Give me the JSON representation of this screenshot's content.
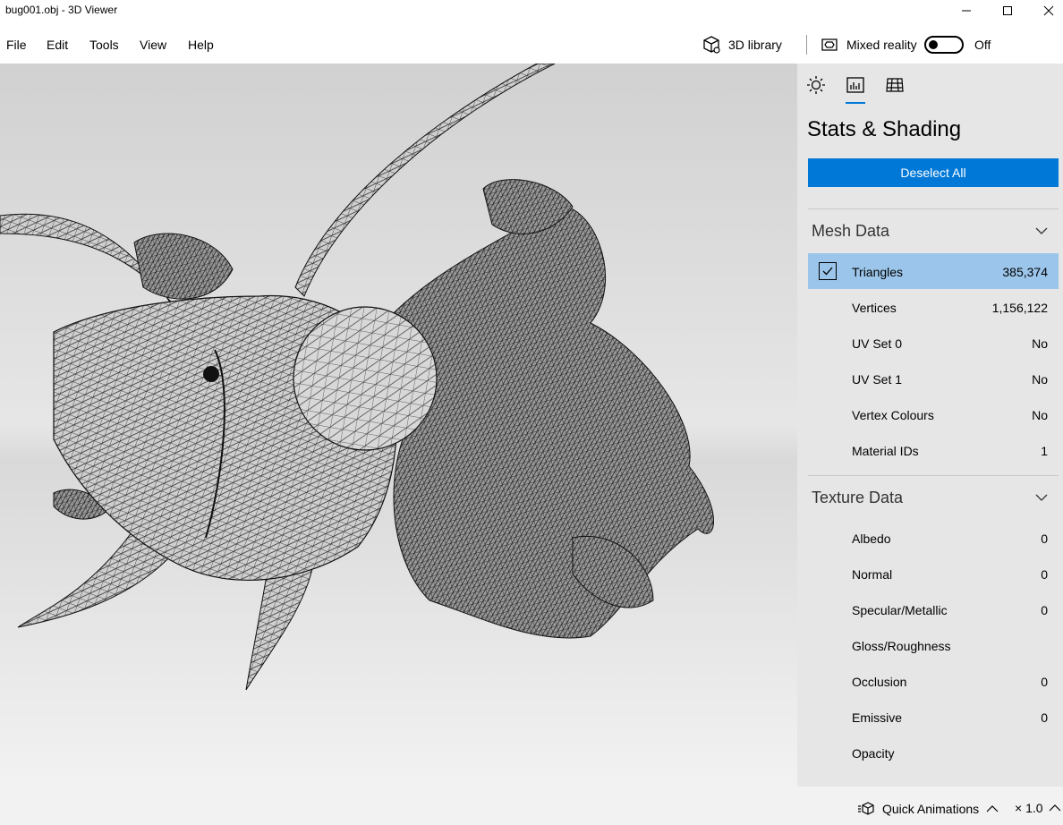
{
  "window": {
    "title": "bug001.obj - 3D Viewer"
  },
  "menu": {
    "items": [
      "File",
      "Edit",
      "Tools",
      "View",
      "Help"
    ],
    "library_label": "3D library",
    "mixed_reality_label": "Mixed reality",
    "mixed_reality_state": "Off"
  },
  "panel": {
    "tabs": [
      "lighting-tab",
      "stats-tab",
      "grid-tab"
    ],
    "active_tab": "stats-tab",
    "title": "Stats & Shading",
    "deselect_label": "Deselect All",
    "mesh_header": "Mesh Data",
    "mesh_rows": [
      {
        "name": "Triangles",
        "value": "385,374",
        "checked": true
      },
      {
        "name": "Vertices",
        "value": "1,156,122"
      },
      {
        "name": "UV Set 0",
        "value": "No"
      },
      {
        "name": "UV Set 1",
        "value": "No"
      },
      {
        "name": "Vertex Colours",
        "value": "No"
      },
      {
        "name": "Material IDs",
        "value": "1"
      }
    ],
    "texture_header": "Texture Data",
    "texture_rows": [
      {
        "name": "Albedo",
        "value": "0"
      },
      {
        "name": "Normal",
        "value": "0"
      },
      {
        "name": "Specular/Metallic",
        "value": "0"
      },
      {
        "name": "Gloss/Roughness",
        "value": ""
      },
      {
        "name": "Occlusion",
        "value": "0"
      },
      {
        "name": "Emissive",
        "value": "0"
      },
      {
        "name": "Opacity",
        "value": ""
      }
    ]
  },
  "bottom": {
    "quick_animations_label": "Quick Animations",
    "speed_label": "× 1.0"
  },
  "colors": {
    "accent": "#0078d7",
    "selected_row": "#9bc5ea",
    "panel_bg": "#e6e6e6"
  }
}
